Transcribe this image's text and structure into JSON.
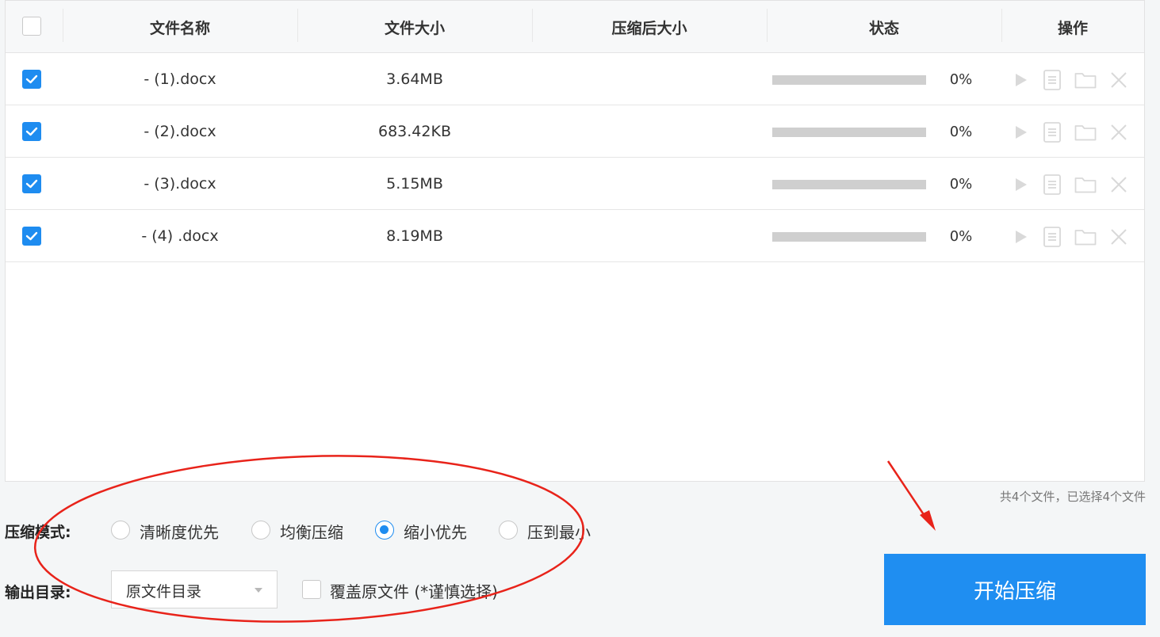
{
  "table": {
    "headers": {
      "name": "文件名称",
      "size": "文件大小",
      "compressed": "压缩后大小",
      "status": "状态",
      "actions": "操作"
    },
    "rows": [
      {
        "name": "- (1).docx",
        "size": "3.64MB",
        "compressed": "",
        "progress": 0,
        "progress_text": "0%",
        "checked": true
      },
      {
        "name": "- (2).docx",
        "size": "683.42KB",
        "compressed": "",
        "progress": 0,
        "progress_text": "0%",
        "checked": true
      },
      {
        "name": "- (3).docx",
        "size": "5.15MB",
        "compressed": "",
        "progress": 0,
        "progress_text": "0%",
        "checked": true
      },
      {
        "name": "- (4) .docx",
        "size": "8.19MB",
        "compressed": "",
        "progress": 0,
        "progress_text": "0%",
        "checked": true
      }
    ]
  },
  "summary": "共4个文件，已选择4个文件",
  "mode": {
    "label": "压缩模式:",
    "options": [
      "清晰度优先",
      "均衡压缩",
      "缩小优先",
      "压到最小"
    ],
    "selected": "缩小优先"
  },
  "output": {
    "label": "输出目录:",
    "directory": "原文件目录",
    "overwrite_label": "覆盖原文件 (*谨慎选择)",
    "overwrite_checked": false
  },
  "start_button": "开始压缩",
  "colors": {
    "accent": "#1e8cf0",
    "annotation": "#e8231a",
    "progress_track": "#cfcfcf"
  }
}
